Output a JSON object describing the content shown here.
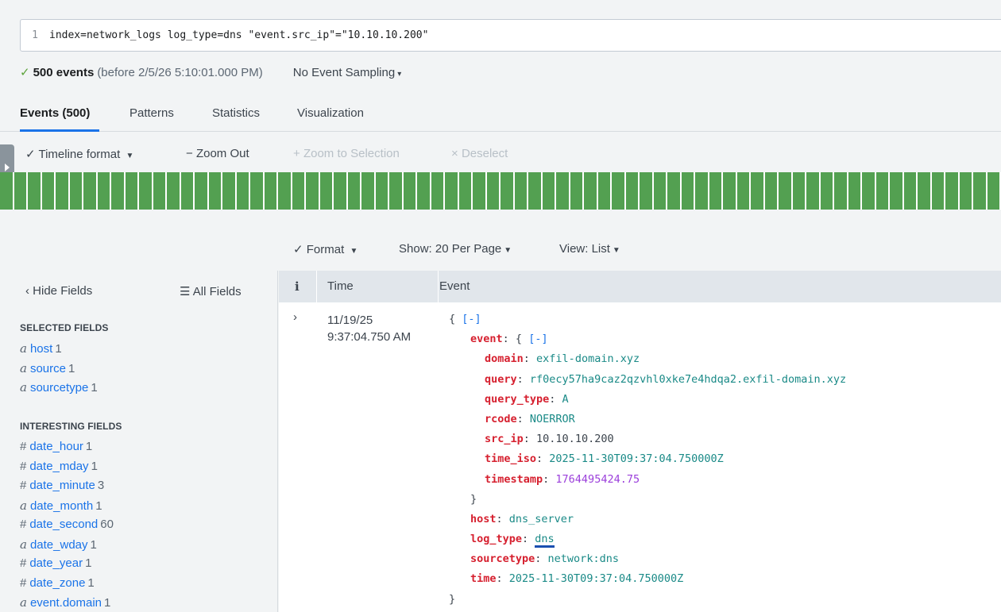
{
  "search": {
    "line_number": "1",
    "query": "index=network_logs log_type=dns \"event.src_ip\"=\"10.10.10.200\""
  },
  "summary": {
    "check": "✓",
    "count": "500 events",
    "range": "(before 2/5/26 5:10:01.000 PM)",
    "sampling": "No Event Sampling",
    "sampling_caret": "▾"
  },
  "tabs": [
    "Events (500)",
    "Patterns",
    "Statistics",
    "Visualization"
  ],
  "timeline": {
    "format_label": "Timeline format",
    "zoom_out": "Zoom Out",
    "zoom_to_selection": "Zoom to Selection",
    "deselect": "Deselect",
    "bar_color": "#53a051",
    "bar_count": 72
  },
  "results_tools": {
    "format": "Format",
    "show": "Show: 20 Per Page",
    "view": "View: List"
  },
  "sidebar": {
    "hide_fields": "Hide Fields",
    "all_fields": "All Fields",
    "selected_title": "SELECTED FIELDS",
    "selected": [
      {
        "type": "a",
        "name": "host",
        "count": "1"
      },
      {
        "type": "a",
        "name": "source",
        "count": "1"
      },
      {
        "type": "a",
        "name": "sourcetype",
        "count": "1"
      }
    ],
    "interesting_title": "INTERESTING FIELDS",
    "interesting": [
      {
        "type": "#",
        "name": "date_hour",
        "count": "1"
      },
      {
        "type": "#",
        "name": "date_mday",
        "count": "1"
      },
      {
        "type": "#",
        "name": "date_minute",
        "count": "3"
      },
      {
        "type": "a",
        "name": "date_month",
        "count": "1"
      },
      {
        "type": "#",
        "name": "date_second",
        "count": "60"
      },
      {
        "type": "a",
        "name": "date_wday",
        "count": "1"
      },
      {
        "type": "#",
        "name": "date_year",
        "count": "1"
      },
      {
        "type": "#",
        "name": "date_zone",
        "count": "1"
      },
      {
        "type": "a",
        "name": "event.domain",
        "count": "1"
      }
    ]
  },
  "table": {
    "headers": {
      "info": "i",
      "time": "Time",
      "event": "Event"
    },
    "expand": "›",
    "time_date": "11/19/25",
    "time_clock": "9:37:04.750 AM",
    "event": {
      "open": "{",
      "collapse": "[-]",
      "event_key": "event",
      "event_open": "{",
      "event_fields": [
        {
          "key": "domain",
          "value": "exfil-domain.xyz",
          "kind": "s"
        },
        {
          "key": "query",
          "value": "rf0ecy57ha9caz2qzvhl0xke7e4hdqa2.exfil-domain.xyz",
          "kind": "s"
        },
        {
          "key": "query_type",
          "value": "A",
          "kind": "s"
        },
        {
          "key": "rcode",
          "value": "NOERROR",
          "kind": "s"
        },
        {
          "key": "src_ip",
          "value": "10.10.10.200",
          "kind": "p"
        },
        {
          "key": "time_iso",
          "value": "2025-11-30T09:37:04.750000Z",
          "kind": "s"
        },
        {
          "key": "timestamp",
          "value": "1764495424.75",
          "kind": "n"
        }
      ],
      "event_close": "}",
      "top_fields": [
        {
          "key": "host",
          "value": "dns_server",
          "kind": "s"
        },
        {
          "key": "log_type",
          "value": "dns",
          "kind": "s",
          "selected": true
        },
        {
          "key": "sourcetype",
          "value": "network:dns",
          "kind": "s"
        },
        {
          "key": "time",
          "value": "2025-11-30T09:37:04.750000Z",
          "kind": "s"
        }
      ],
      "close": "}"
    }
  }
}
